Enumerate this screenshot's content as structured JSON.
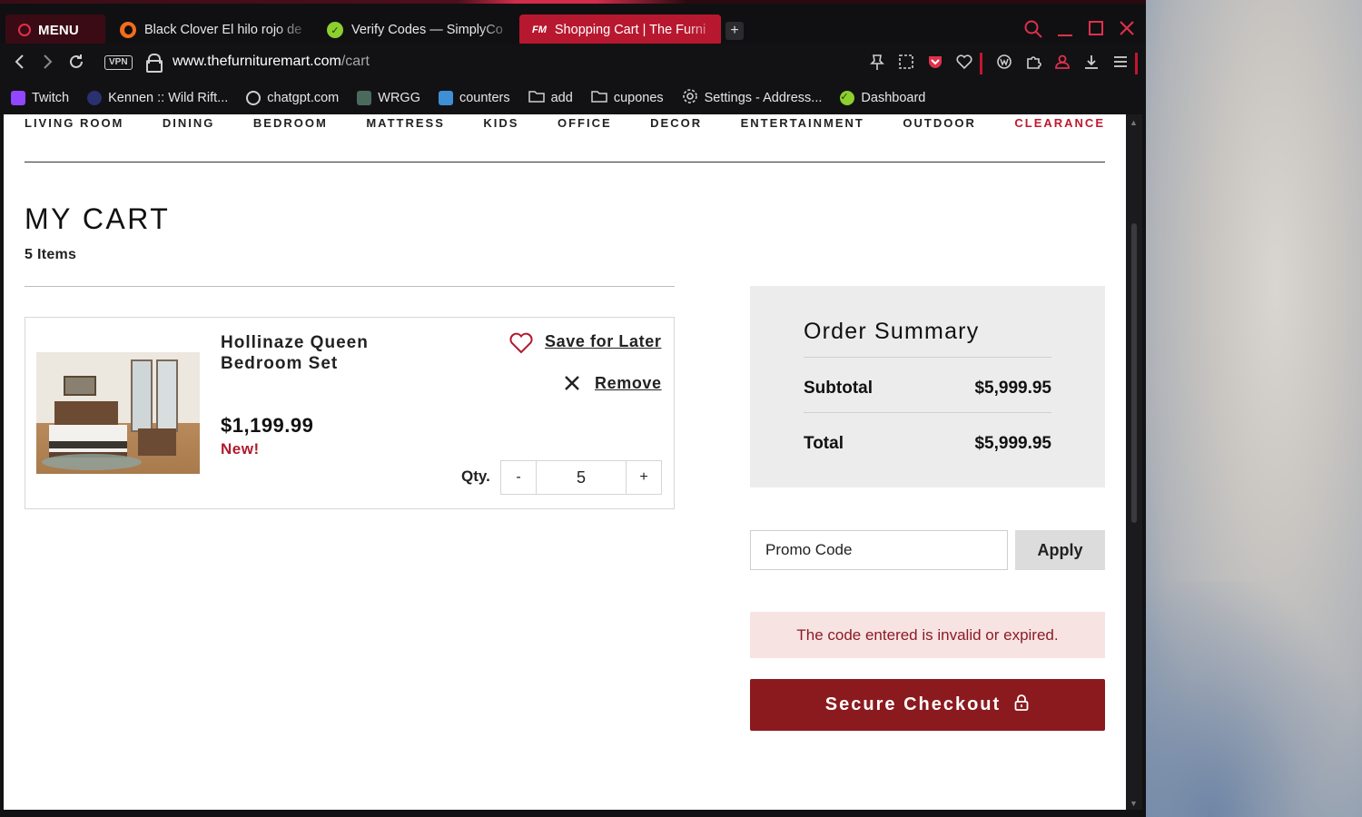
{
  "browser": {
    "menu_label": "MENU",
    "tabs": [
      {
        "title": "Black Clover El hilo rojo de",
        "icon": "crunchyroll-icon"
      },
      {
        "title": "Verify Codes — SimplyCo",
        "icon": "simplycodes-icon"
      },
      {
        "title": "Shopping Cart | The Furni",
        "icon": "furniture-mart-icon",
        "favicon_text": "FM",
        "active": true
      }
    ],
    "new_tab_label": "+",
    "vpn_label": "VPN",
    "url_host": "www.thefurnituremart.com",
    "url_path": "/cart",
    "accent_color": "#e0304c"
  },
  "bookmarks": [
    {
      "label": "Twitch",
      "icon": "twitch-icon",
      "color": "#9146ff"
    },
    {
      "label": "Kennen :: Wild Rift...",
      "icon": "wildrift-icon",
      "color": "#3a3f9e"
    },
    {
      "label": "chatgpt.com",
      "icon": "openai-icon",
      "color": "#cfcfcf"
    },
    {
      "label": "WRGG",
      "icon": "wrgg-icon",
      "color": "#4a6b5c"
    },
    {
      "label": "counters",
      "icon": "counters-icon",
      "color": "#3f8fd6"
    },
    {
      "label": "add",
      "icon": "folder-icon",
      "color": "#cfcfcf"
    },
    {
      "label": "cupones",
      "icon": "folder-icon",
      "color": "#cfcfcf"
    },
    {
      "label": "Settings - Address...",
      "icon": "gear-icon",
      "color": "#cfcfcf"
    },
    {
      "label": "Dashboard",
      "icon": "simplycodes-icon",
      "color": "#8ccf2e"
    }
  ],
  "categories": [
    {
      "label": "LIVING ROOM"
    },
    {
      "label": "DINING"
    },
    {
      "label": "BEDROOM"
    },
    {
      "label": "MATTRESS"
    },
    {
      "label": "KIDS"
    },
    {
      "label": "OFFICE"
    },
    {
      "label": "DECOR"
    },
    {
      "label": "ENTERTAINMENT"
    },
    {
      "label": "OUTDOOR"
    },
    {
      "label": "CLEARANCE",
      "highlight": true
    }
  ],
  "cart": {
    "title": "MY CART",
    "items_count": "5 Items",
    "item": {
      "name": "Hollinaze Queen Bedroom Set",
      "price": "$1,199.99",
      "badge": "New!",
      "save_label": "Save for Later",
      "remove_label": "Remove",
      "qty_label": "Qty.",
      "qty_minus": "-",
      "qty_value": "5",
      "qty_plus": "+"
    }
  },
  "summary": {
    "title": "Order Summary",
    "subtotal_label": "Subtotal",
    "subtotal_value": "$5,999.95",
    "total_label": "Total",
    "total_value": "$5,999.95"
  },
  "promo": {
    "value": "Promo Code",
    "apply_label": "Apply",
    "error": "The code entered is invalid or expired."
  },
  "checkout": {
    "label": "Secure Checkout",
    "color": "#8b1a1e"
  }
}
